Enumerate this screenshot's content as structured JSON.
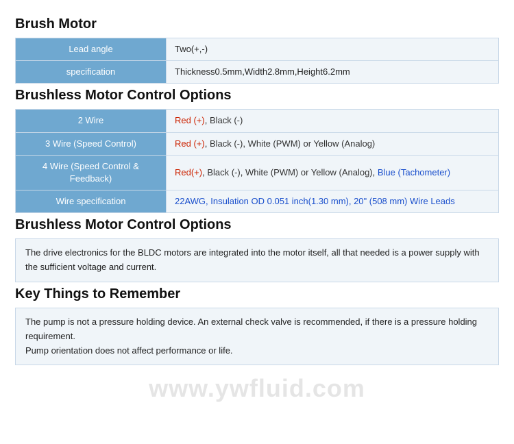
{
  "sections": {
    "brush_motor": {
      "title": "Brush Motor",
      "rows": [
        {
          "label": "Lead angle",
          "value": "Two(+,-)"
        },
        {
          "label": "specification",
          "value": "Thickness0.5mm,Width2.8mm,Height6.2mm"
        }
      ]
    },
    "brushless_control_options": {
      "title": "Brushless Motor Control Options",
      "rows": [
        {
          "label": "2 Wire",
          "value_parts": [
            {
              "text": "Red (+), Black (-)",
              "color": "colored"
            }
          ]
        },
        {
          "label": "3 Wire (Speed Control)",
          "value_parts": [
            {
              "text": "Red (+), Black (-), White (PWM) or Yellow (Analog)",
              "color": "colored"
            }
          ]
        },
        {
          "label": "4 Wire (Speed Control & Feedback)",
          "value_parts": [
            {
              "text": "Red(+), Black (-), White (PWM) or Yellow (Analog), Blue (Tachometer)",
              "color": "colored"
            }
          ]
        },
        {
          "label": "Wire specification",
          "value_parts": [
            {
              "text": "22AWG, Insulation OD 0.051 inch(1.30 mm), 20\" (508 mm) Wire Leads",
              "color": "colored"
            }
          ]
        }
      ]
    },
    "brushless_motor_desc": {
      "title": "Brushless Motor Control Options",
      "description": "The drive electronics for the BLDC motors are integrated into the motor itself, all that needed is a power supply with the sufficient voltage and current."
    },
    "key_things": {
      "title": "Key Things to Remember",
      "lines": [
        "The pump is not a pressure holding device. An external check valve is recommended, if there is a pressure holding requirement.",
        "Pump orientation does not affect performance or life."
      ]
    }
  },
  "watermark": "www.ywfluid.com"
}
